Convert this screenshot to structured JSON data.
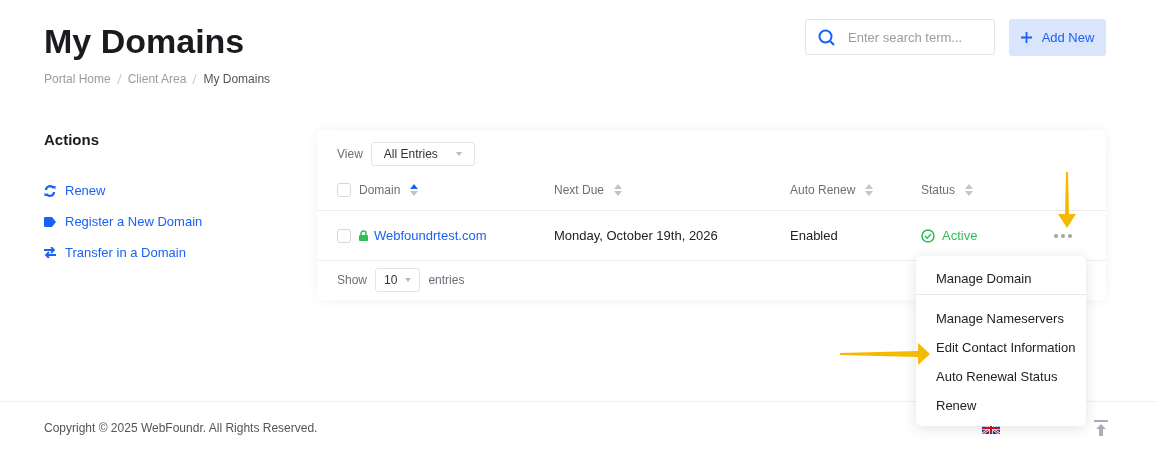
{
  "page": {
    "title": "My Domains",
    "breadcrumb": [
      {
        "label": "Portal Home",
        "current": false
      },
      {
        "label": "Client Area",
        "current": false
      },
      {
        "label": "My Domains",
        "current": true
      }
    ]
  },
  "search": {
    "placeholder": "Enter search term..."
  },
  "add_button": "Add New",
  "sidebar": {
    "title": "Actions",
    "items": [
      {
        "label": "Renew",
        "kind": "renew"
      },
      {
        "label": "Register a New Domain",
        "kind": "register"
      },
      {
        "label": "Transfer in a Domain",
        "kind": "transfer"
      }
    ]
  },
  "table": {
    "view_label": "View",
    "view_value": "All Entries",
    "columns": [
      {
        "label": "Domain",
        "sorted": true
      },
      {
        "label": "Next Due",
        "sorted": false
      },
      {
        "label": "Auto Renew",
        "sorted": false
      },
      {
        "label": "Status",
        "sorted": false
      }
    ],
    "select_all_checked": false,
    "rows": [
      {
        "checked": false,
        "domain": "Webfoundrtest.com",
        "next_due": "Monday, October 19th, 2026",
        "auto_renew": "Enabled",
        "status": "Active",
        "kind": "active"
      }
    ],
    "show_label": "Show",
    "page_size": "10",
    "entries_label": "entries"
  },
  "menu": {
    "items": [
      {
        "label": "Manage Domain",
        "divider_after": true
      },
      {
        "label": "Manage Nameservers",
        "divider_after": false
      },
      {
        "label": "Edit Contact Information",
        "divider_after": false
      },
      {
        "label": "Auto Renewal Status",
        "divider_after": false
      },
      {
        "label": "Renew",
        "divider_after": false
      }
    ]
  },
  "footer": {
    "copyright": "Copyright © 2025 WebFoundr. All Rights Reserved."
  }
}
